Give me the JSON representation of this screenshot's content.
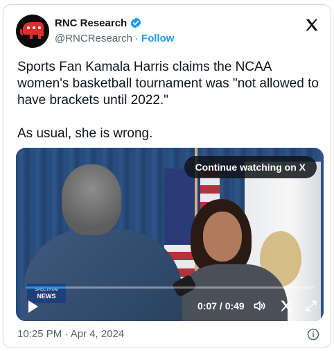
{
  "author": {
    "display_name": "RNC Research",
    "handle": "@RNCResearch",
    "separator": "·",
    "follow_label": "Follow"
  },
  "tweet": {
    "text": "Sports Fan Kamala Harris claims the NCAA women's basketball tournament was \"not allowed to have brackets until 2022.\"\n\nAs usual, she is wrong."
  },
  "video": {
    "continue_label": "Continue watching on X",
    "channel_small": "SPECTRUM",
    "channel_big": "NEWS",
    "time": "0:07 / 0:49",
    "progress_fraction": 0.14
  },
  "footer": {
    "timestamp": "10:25 PM · Apr 4, 2024"
  },
  "icons": {
    "platform": "x-logo-icon",
    "verified": "verified-badge-icon",
    "play": "play-icon",
    "volume": "volume-icon",
    "x_video": "x-logo-icon",
    "fullscreen": "fullscreen-icon",
    "info": "info-icon"
  },
  "colors": {
    "accent": "#1d9bf0",
    "text": "#0f1419",
    "muted": "#536471"
  }
}
